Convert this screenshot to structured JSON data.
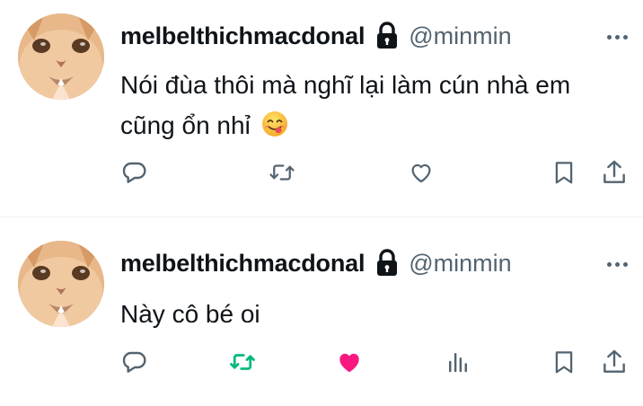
{
  "colors": {
    "text_primary": "#0f1419",
    "text_secondary": "#536471",
    "retweet_active": "#00ba7c",
    "like_active": "#f91880",
    "divider": "#eff3f4"
  },
  "tweets": [
    {
      "display_name": "melbelthichmacdonal",
      "handle": "@minmin",
      "protected_icon": "lock-icon",
      "text": "Nói đùa thôi mà nghĩ lại làm cún nhà em cũng ổn nhỉ",
      "emoji": "face-savoring-food",
      "retweeted": false,
      "liked": false,
      "actions": [
        "reply-icon",
        "retweet-icon",
        "like-icon",
        "bookmark-icon",
        "share-icon"
      ]
    },
    {
      "display_name": "melbelthichmacdonal",
      "handle": "@minmin",
      "protected_icon": "lock-icon",
      "text": "Này cô bé oi",
      "emoji": "",
      "retweeted": true,
      "liked": true,
      "actions": [
        "reply-icon",
        "retweet-icon",
        "like-icon",
        "analytics-icon",
        "bookmark-icon",
        "share-icon"
      ]
    }
  ]
}
